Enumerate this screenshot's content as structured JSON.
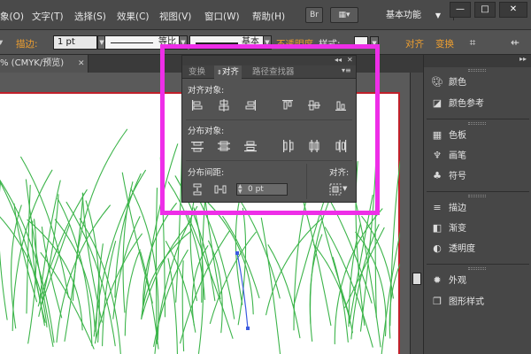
{
  "menubar": {
    "items": [
      "象(O)",
      "文字(T)",
      "选择(S)",
      "效果(C)",
      "视图(V)",
      "窗口(W)",
      "帮助(H)"
    ],
    "bridge_label": "Br",
    "workspace_label": "基本功能",
    "win_min": "—",
    "win_max": "□",
    "win_close": "✕"
  },
  "controlbar": {
    "stroke_label": "描边:",
    "stroke_value": "1 pt",
    "profile1_label": "等比",
    "profile2_label": "基本",
    "opacity_label": "不透明度",
    "style_label": "样式:",
    "align_label": "对齐",
    "transform_label": "变换"
  },
  "doctab": {
    "title": "% (CMYK/预览)",
    "close": "✕"
  },
  "alignpanel": {
    "collapse": "◂◂",
    "close": "✕",
    "tabs": [
      "变换",
      "对齐",
      "路径查找器"
    ],
    "menu_icon": "▾≡",
    "align_objects_label": "对齐对象:",
    "distribute_objects_label": "分布对象:",
    "distribute_spacing_label": "分布间距:",
    "align_to_label": "对齐:",
    "spacing_value": "0 pt"
  },
  "rightdock": {
    "items": [
      {
        "label": "颜色",
        "icon": "palette-icon"
      },
      {
        "label": "颜色参考",
        "icon": "color-guide-icon"
      },
      {
        "label": "色板",
        "icon": "swatches-icon"
      },
      {
        "label": "画笔",
        "icon": "brush-icon"
      },
      {
        "label": "符号",
        "icon": "symbols-icon"
      },
      {
        "label": "描边",
        "icon": "stroke-icon"
      },
      {
        "label": "渐变",
        "icon": "gradient-icon"
      },
      {
        "label": "透明度",
        "icon": "transparency-icon"
      },
      {
        "label": "外观",
        "icon": "appearance-icon"
      },
      {
        "label": "图形样式",
        "icon": "graphic-styles-icon"
      }
    ]
  },
  "colors": {
    "highlight": "#ee2ee8",
    "grass": "#3cb44a",
    "selected_path": "#3a5adf",
    "artboard_border": "#c0202a",
    "accent_orange": "#f0a030"
  }
}
